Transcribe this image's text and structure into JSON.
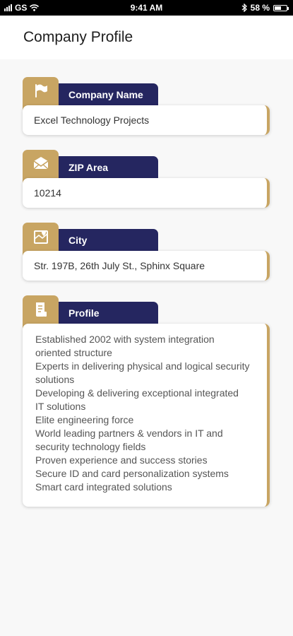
{
  "status_bar": {
    "carrier": "GS",
    "time": "9:41 AM",
    "battery_percent": "58 %",
    "battery_level": 0.58
  },
  "header": {
    "title": "Company Profile"
  },
  "sections": [
    {
      "label": "Company Name",
      "icon": "flag-icon",
      "value": "Excel Technology Projects"
    },
    {
      "label": "ZIP Area",
      "icon": "envelope-icon",
      "value": "10214"
    },
    {
      "label": "City",
      "icon": "map-icon",
      "value": "Str. 197B, 26th July St., Sphinx Square"
    },
    {
      "label": "Profile",
      "icon": "document-icon",
      "lines": [
        "Established 2002 with system integration",
        "oriented structure",
        "Experts in delivering physical and logical security",
        "solutions",
        "Developing & delivering exceptional integrated",
        "IT solutions",
        "Elite engineering  force",
        "World leading partners & vendors in IT and",
        "security technology fields",
        "Proven experience and success stories",
        "Secure ID and card personalization systems",
        "Smart card integrated solutions"
      ]
    }
  ],
  "colors": {
    "gold": "#c8a563",
    "navy": "#252660"
  }
}
